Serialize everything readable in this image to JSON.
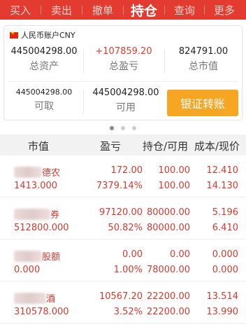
{
  "tabs": [
    {
      "label": "买入"
    },
    {
      "label": "卖出"
    },
    {
      "label": "撤单"
    },
    {
      "label": "持仓"
    },
    {
      "label": "查询"
    },
    {
      "label": "更多"
    }
  ],
  "active_tab": "持仓",
  "account": {
    "label": "人民币账户CNY",
    "total_assets_value": "445004298.00",
    "total_assets_label": "总资产",
    "total_pnl_value": "+107859.20",
    "total_pnl_label": "总盈亏",
    "market_value_value": "824791.00",
    "market_value_label": "总市值",
    "withdrawable_value": "445004298.00",
    "withdrawable_label": "可取",
    "available_value": "445004298.00",
    "available_label": "可用",
    "transfer_button": "银证转账"
  },
  "pager": {
    "count": 3,
    "active": 1
  },
  "table": {
    "headers": [
      "市值",
      "盈亏",
      "持仓/可用",
      "成本/现价"
    ],
    "rows": [
      {
        "name": "德农",
        "market_value": "1413.000",
        "pnl": "172.00",
        "pnl_pct": "7379.14%",
        "position": "100.00",
        "available": "100.00",
        "cost": "12.410",
        "price": "14.130"
      },
      {
        "name": "券",
        "market_value": "512800.000",
        "pnl": "97120.00",
        "pnl_pct": "50.82%",
        "position": "80000.00",
        "available": "80000.00",
        "cost": "5.196",
        "price": "6.410"
      },
      {
        "name": "股额",
        "market_value": "0.000",
        "pnl": "0.00",
        "pnl_pct": "1.00%",
        "position": "0.00",
        "available": "78000.00",
        "cost": "0.000",
        "price": "0.000"
      },
      {
        "name": "酒",
        "market_value": "310578.000",
        "pnl": "10567.20",
        "pnl_pct": "3.52%",
        "position": "22200.00",
        "available": "22200.00",
        "cost": "13.514",
        "price": "13.990"
      }
    ]
  },
  "colors": {
    "brand": "#e33b2f",
    "accent": "#f6a623",
    "gain": "#d33a2f"
  }
}
